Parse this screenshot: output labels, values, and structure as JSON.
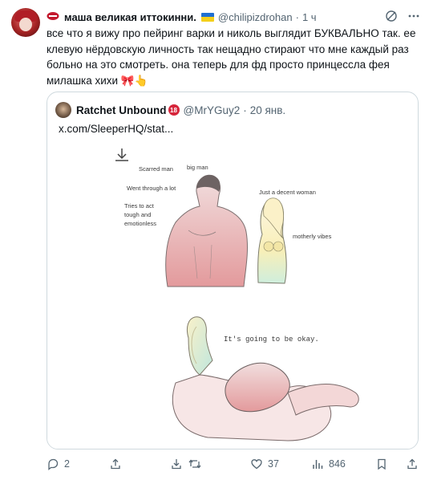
{
  "post": {
    "author_display": "маша великая иттокинни.",
    "handle": "@chilipizdrohan",
    "time": "1 ч",
    "text": "все что я вижу про пейринг варки и николь выглядит БУКВАЛЬНО так. ее клевую нёрдовскую личность так нещадно стирают что мне каждый раз больно на это смотреть. она теперь для фд просто принцессла фея милашка хихи 🎀👆"
  },
  "quote": {
    "author": "Ratchet Unbound",
    "badge": "18",
    "handle": "@MrYGuy2",
    "date": "20 янв.",
    "text": "x.com/SleeperHQ/stat...",
    "image_labels": {
      "scarred": "Scarred man",
      "big": "big man",
      "went": "Went through a lot",
      "tries1": "Tries to act",
      "tries2": "tough and",
      "tries3": "emotionless",
      "decent": "Just a decent woman",
      "motherly": "motherly vibes",
      "okay": "It's going to be okay."
    }
  },
  "actions": {
    "replies": "2",
    "likes": "37",
    "views": "846"
  },
  "colors": {
    "muted": "#536471",
    "border": "#cfd9de",
    "text": "#0f1419"
  }
}
